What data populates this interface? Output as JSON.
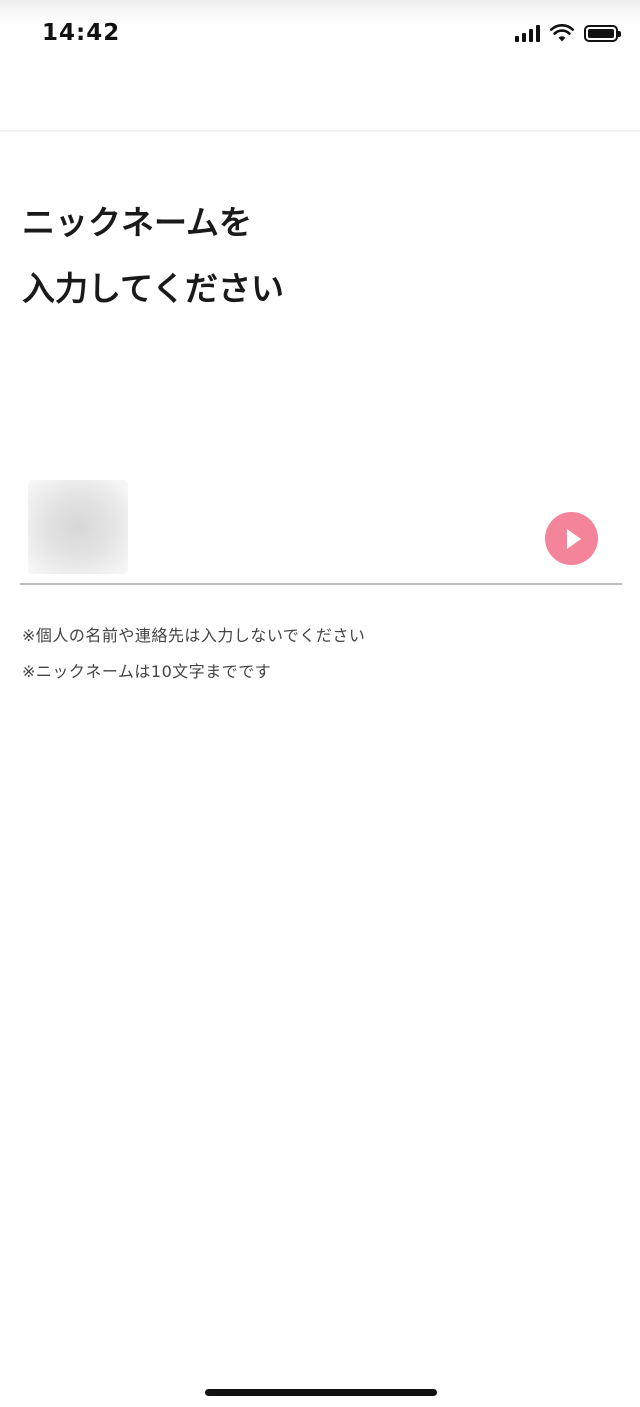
{
  "status_bar": {
    "time": "14:42",
    "icons": [
      "signal-icon",
      "wifi-icon",
      "battery-icon"
    ]
  },
  "page": {
    "title_line1": "ニックネームを",
    "title_line2": "入力してください"
  },
  "nickname_input": {
    "value": "",
    "submit_icon": "play-icon",
    "submit_color": "#f4849a"
  },
  "notes": [
    "※個人の名前や連絡先は入力しないでください",
    "※ニックネームは10文字までです"
  ]
}
